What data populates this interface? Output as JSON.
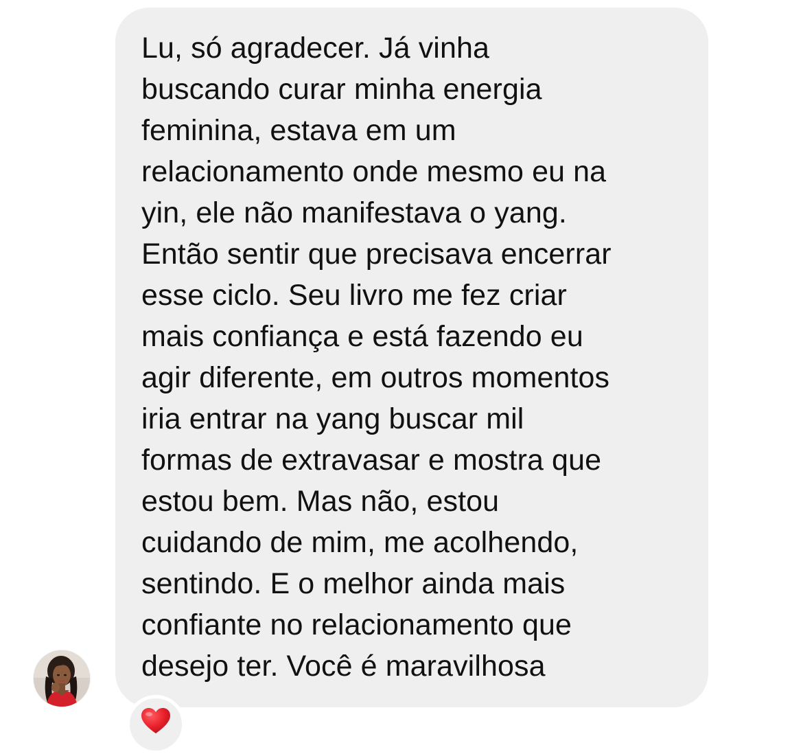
{
  "message": {
    "lines": [
      "Lu, só agradecer. Já vinha",
      "buscando curar minha energia",
      "feminina, estava em um",
      "relacionamento onde mesmo eu na",
      "yin, ele não manifestava o yang.",
      "Então sentir que precisava encerrar",
      "esse ciclo. Seu livro me fez criar",
      "mais confiança e está fazendo eu",
      "agir diferente, em outros momentos",
      "iria entrar na yang buscar mil",
      "formas de extravasar e mostra que",
      "estou bem. Mas não, estou",
      "cuidando de mim, me acolhendo,",
      "sentindo. E o melhor ainda mais",
      "confiante no relacionamento que",
      "desejo ter. Você é maravilhosa"
    ]
  },
  "reaction": {
    "icon": "heart-icon",
    "color": "#e8202a"
  },
  "avatar": {
    "icon": "user-avatar"
  },
  "colors": {
    "bubble": "#efefef",
    "text": "#111111",
    "background": "#ffffff"
  }
}
